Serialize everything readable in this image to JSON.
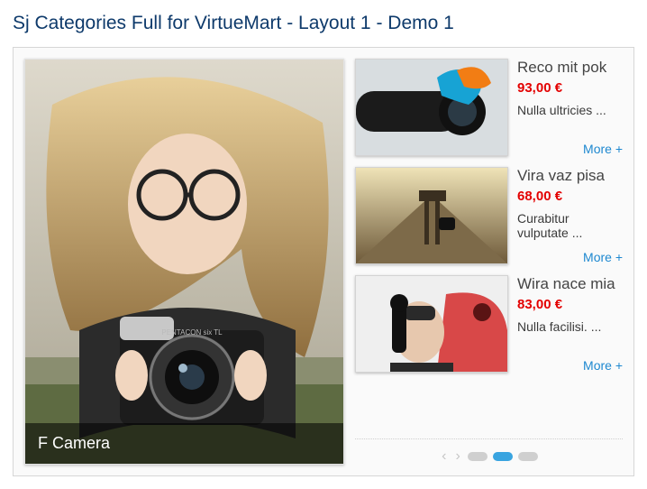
{
  "title": "Sj Categories Full for VirtueMart - Layout 1 - Demo 1",
  "feature": {
    "caption": "F Camera"
  },
  "more_label": "More +",
  "products": [
    {
      "title": "Reco mit pok",
      "price": "93,00 €",
      "desc": "Nulla ultricies ..."
    },
    {
      "title": "Vira vaz pisa",
      "price": "68,00 €",
      "desc": "Curabitur vulputate ..."
    },
    {
      "title": "Wira nace mia",
      "price": "83,00 €",
      "desc": "Nulla facilisi. ..."
    }
  ],
  "pager": {
    "count": 3,
    "active": 1
  }
}
